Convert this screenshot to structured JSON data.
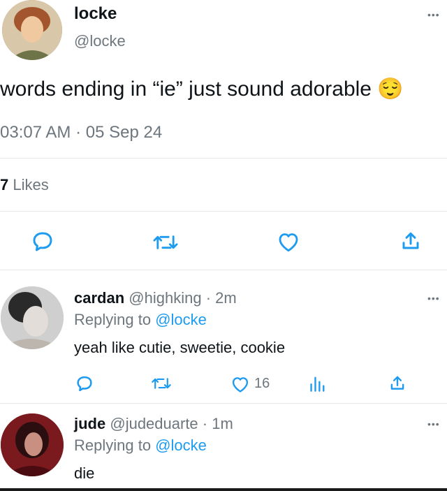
{
  "tweet": {
    "author_name": "locke",
    "author_handle": "@locke",
    "text": "words ending in “ie” just sound adorable 😌",
    "time": "03:07 AM · 05 Sep 24",
    "likes_count": "7",
    "likes_label": "Likes"
  },
  "replies": [
    {
      "name": "cardan",
      "handle": "@highking",
      "time": "· 2m",
      "replying_prefix": "Replying to",
      "replying_to": "@locke",
      "text": "yeah like cutie, sweetie, cookie",
      "like_count": "16"
    },
    {
      "name": "jude",
      "handle": "@judeduarte",
      "time": "· 1m",
      "replying_prefix": "Replying to",
      "replying_to": "@locke",
      "text": "die"
    }
  ],
  "more_glyph": "•••",
  "colors": {
    "accent": "#1d9bf0",
    "muted": "#6e767d",
    "divider": "#e6e9eb"
  },
  "icons": [
    "reply-icon",
    "retweet-icon",
    "like-icon",
    "share-icon",
    "analytics-icon",
    "more-icon"
  ]
}
